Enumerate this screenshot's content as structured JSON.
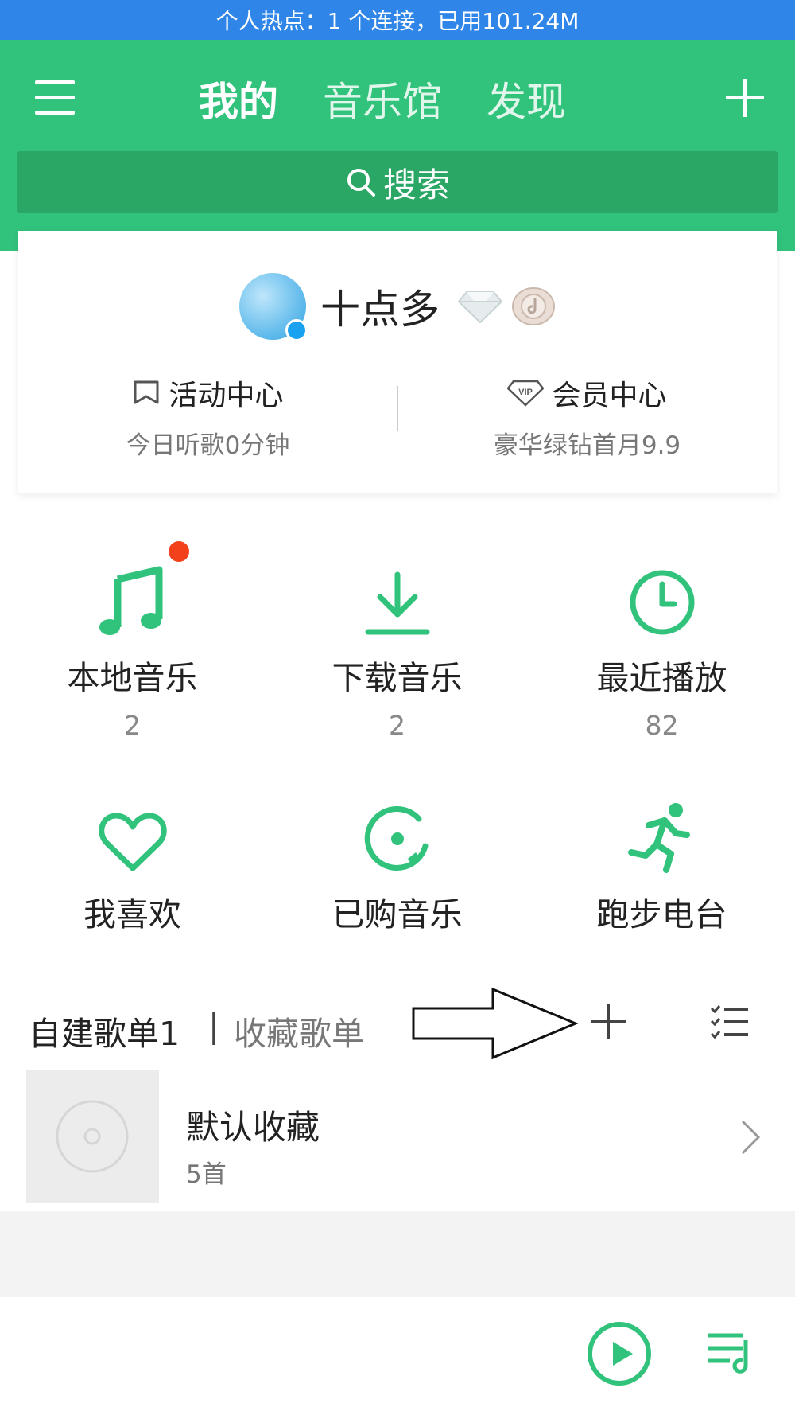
{
  "status_bar": {
    "text": "个人热点：1 个连接，已用101.24M"
  },
  "header": {
    "tabs": [
      {
        "label": "我的",
        "active": true
      },
      {
        "label": "音乐馆",
        "active": false
      },
      {
        "label": "发现",
        "active": false
      }
    ],
    "search_label": "搜索"
  },
  "profile": {
    "username": "十点多",
    "activity": {
      "title": "活动中心",
      "subtitle": "今日听歌0分钟"
    },
    "vip": {
      "title": "会员中心",
      "subtitle": "豪华绿钻首月9.9"
    }
  },
  "functions": [
    {
      "label": "本地音乐",
      "count": "2",
      "icon": "music-note-icon",
      "has_dot": true
    },
    {
      "label": "下载音乐",
      "count": "2",
      "icon": "download-icon"
    },
    {
      "label": "最近播放",
      "count": "82",
      "icon": "clock-icon"
    },
    {
      "label": "我喜欢",
      "count": "",
      "icon": "heart-icon"
    },
    {
      "label": "已购音乐",
      "count": "",
      "icon": "purchased-disc-icon"
    },
    {
      "label": "跑步电台",
      "count": "",
      "icon": "runner-icon"
    }
  ],
  "playlists": {
    "tab_created": "自建歌单1",
    "separator": "|",
    "tab_collected": "收藏歌单",
    "items": [
      {
        "name": "默认收藏",
        "count": "5首"
      }
    ]
  },
  "colors": {
    "brand_green": "#31c27c",
    "status_blue": "#2f86e8",
    "red_dot": "#f3421b"
  }
}
